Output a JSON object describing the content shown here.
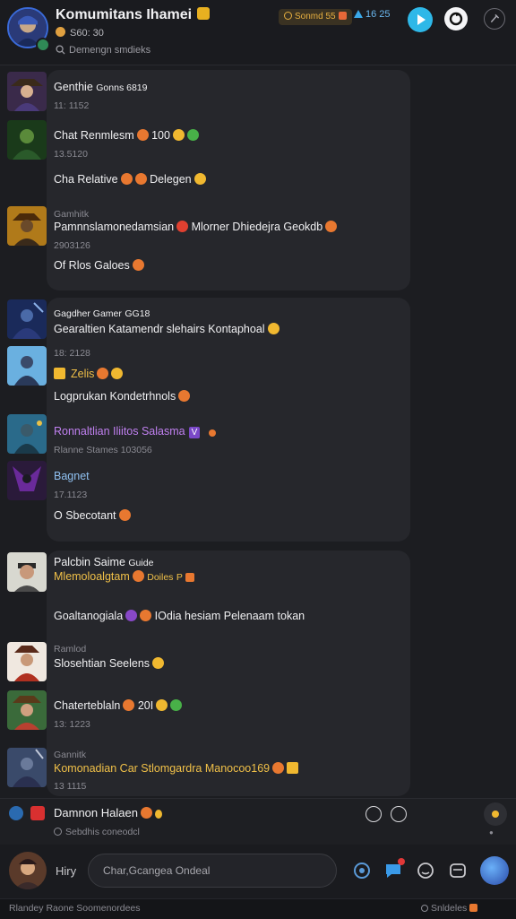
{
  "header": {
    "title": "Komumitans Ihamei",
    "subtitle": "S60: 30",
    "search_placeholder": "Demengn smdieks",
    "pill_text": "Sonmd 55",
    "stat_text": "16 25"
  },
  "card1": {
    "m1": {
      "name": "Genthie",
      "tag": "Gonns 6819",
      "time": "11: 1152"
    },
    "m2": {
      "text": "Chat Renmlesm",
      "extra": "100",
      "time": "13.5120"
    },
    "m3": {
      "text": "Cha Relative",
      "extra": "Delegen"
    },
    "m4": {
      "name": "Gamhitk",
      "text": "Pamnnslamonedamsian",
      "highlight": "Mlorner Dhiedejra Geokdb",
      "time": "2903126"
    },
    "m5": {
      "text": "Of Rlos Galoes"
    }
  },
  "card2": {
    "m1": {
      "name": "Gagdher Gamer",
      "tag": "GG18",
      "text": "Gearaltien Katamendr slehairs Kontaphoal",
      "time": "18: 2128"
    },
    "m2": {
      "text": "Zelis"
    },
    "m3": {
      "text": "Logprukan Kondetrhnols"
    },
    "m4": {
      "text": "Ronnaltlian Iliitos Salasma",
      "tag": "V",
      "time": "Rlanne Stames 103056"
    },
    "m5": {
      "name": "Bagnet",
      "time": "17.1123",
      "text": "O Sbecotant"
    }
  },
  "card3": {
    "m1": {
      "name": "Palcbin Saime",
      "tag": "Guide",
      "text": "Mlemoloalgtam",
      "extra": "Doiles",
      "extra2": "P"
    },
    "m2": {
      "text": "Goaltanogiala",
      "highlight": "IOdia hesiam Pelenaam tokan"
    },
    "m3": {
      "name": "Ramlod",
      "text": "Slosehtian",
      "highlight": "Seelens"
    },
    "m4": {
      "text": "Chaterteblaln",
      "extra": "20I",
      "time": "13: 1223"
    },
    "m5": {
      "name": "Gannitk",
      "text": "Komonadian Car Stlomgardra Manocoo169",
      "time": "13 1115"
    }
  },
  "replybar": {
    "text": "Damnon Halaen",
    "sub": "Sebdhis coneodcl"
  },
  "composer": {
    "name": "Hiry",
    "placeholder": "Char,Gcangea Ondeal"
  },
  "footer": {
    "left": "Rlandey Raone Soomenordees",
    "right": "Snldeles"
  },
  "colors": {
    "accent": "#2eb8e8",
    "online": "#2f8a56",
    "gold": "#f0c048",
    "green": "#3ec060"
  }
}
